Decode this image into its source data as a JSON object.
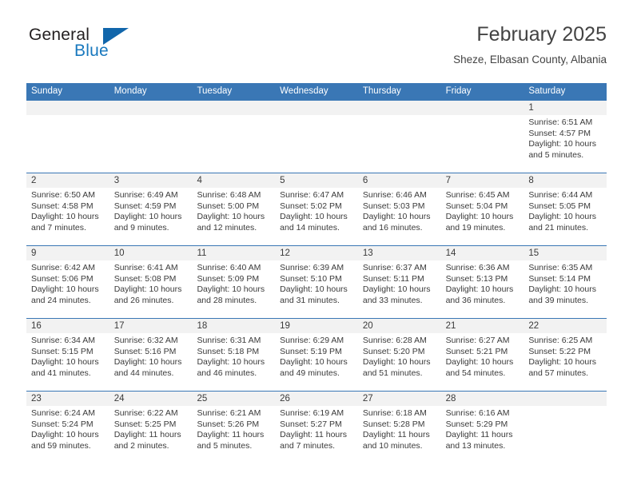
{
  "brand": {
    "name_top": "General",
    "name_bottom": "Blue",
    "accent_color": "#1166ab",
    "text_color": "#231f20"
  },
  "header": {
    "title": "February 2025",
    "subtitle": "Sheze, Elbasan County, Albania"
  },
  "theme": {
    "header_blue": "#3a77b5",
    "daynum_band": "#f2f2f2",
    "body_text": "#3a3a3a"
  },
  "weekdays": [
    "Sunday",
    "Monday",
    "Tuesday",
    "Wednesday",
    "Thursday",
    "Friday",
    "Saturday"
  ],
  "weeks": [
    [
      {
        "day": "",
        "sunrise": "",
        "sunset": "",
        "daylight": "",
        "empty": true
      },
      {
        "day": "",
        "sunrise": "",
        "sunset": "",
        "daylight": "",
        "empty": true
      },
      {
        "day": "",
        "sunrise": "",
        "sunset": "",
        "daylight": "",
        "empty": true
      },
      {
        "day": "",
        "sunrise": "",
        "sunset": "",
        "daylight": "",
        "empty": true
      },
      {
        "day": "",
        "sunrise": "",
        "sunset": "",
        "daylight": "",
        "empty": true
      },
      {
        "day": "",
        "sunrise": "",
        "sunset": "",
        "daylight": "",
        "empty": true
      },
      {
        "day": "1",
        "sunrise": "Sunrise: 6:51 AM",
        "sunset": "Sunset: 4:57 PM",
        "daylight": "Daylight: 10 hours and 5 minutes.",
        "empty": false
      }
    ],
    [
      {
        "day": "2",
        "sunrise": "Sunrise: 6:50 AM",
        "sunset": "Sunset: 4:58 PM",
        "daylight": "Daylight: 10 hours and 7 minutes.",
        "empty": false
      },
      {
        "day": "3",
        "sunrise": "Sunrise: 6:49 AM",
        "sunset": "Sunset: 4:59 PM",
        "daylight": "Daylight: 10 hours and 9 minutes.",
        "empty": false
      },
      {
        "day": "4",
        "sunrise": "Sunrise: 6:48 AM",
        "sunset": "Sunset: 5:00 PM",
        "daylight": "Daylight: 10 hours and 12 minutes.",
        "empty": false
      },
      {
        "day": "5",
        "sunrise": "Sunrise: 6:47 AM",
        "sunset": "Sunset: 5:02 PM",
        "daylight": "Daylight: 10 hours and 14 minutes.",
        "empty": false
      },
      {
        "day": "6",
        "sunrise": "Sunrise: 6:46 AM",
        "sunset": "Sunset: 5:03 PM",
        "daylight": "Daylight: 10 hours and 16 minutes.",
        "empty": false
      },
      {
        "day": "7",
        "sunrise": "Sunrise: 6:45 AM",
        "sunset": "Sunset: 5:04 PM",
        "daylight": "Daylight: 10 hours and 19 minutes.",
        "empty": false
      },
      {
        "day": "8",
        "sunrise": "Sunrise: 6:44 AM",
        "sunset": "Sunset: 5:05 PM",
        "daylight": "Daylight: 10 hours and 21 minutes.",
        "empty": false
      }
    ],
    [
      {
        "day": "9",
        "sunrise": "Sunrise: 6:42 AM",
        "sunset": "Sunset: 5:06 PM",
        "daylight": "Daylight: 10 hours and 24 minutes.",
        "empty": false
      },
      {
        "day": "10",
        "sunrise": "Sunrise: 6:41 AM",
        "sunset": "Sunset: 5:08 PM",
        "daylight": "Daylight: 10 hours and 26 minutes.",
        "empty": false
      },
      {
        "day": "11",
        "sunrise": "Sunrise: 6:40 AM",
        "sunset": "Sunset: 5:09 PM",
        "daylight": "Daylight: 10 hours and 28 minutes.",
        "empty": false
      },
      {
        "day": "12",
        "sunrise": "Sunrise: 6:39 AM",
        "sunset": "Sunset: 5:10 PM",
        "daylight": "Daylight: 10 hours and 31 minutes.",
        "empty": false
      },
      {
        "day": "13",
        "sunrise": "Sunrise: 6:37 AM",
        "sunset": "Sunset: 5:11 PM",
        "daylight": "Daylight: 10 hours and 33 minutes.",
        "empty": false
      },
      {
        "day": "14",
        "sunrise": "Sunrise: 6:36 AM",
        "sunset": "Sunset: 5:13 PM",
        "daylight": "Daylight: 10 hours and 36 minutes.",
        "empty": false
      },
      {
        "day": "15",
        "sunrise": "Sunrise: 6:35 AM",
        "sunset": "Sunset: 5:14 PM",
        "daylight": "Daylight: 10 hours and 39 minutes.",
        "empty": false
      }
    ],
    [
      {
        "day": "16",
        "sunrise": "Sunrise: 6:34 AM",
        "sunset": "Sunset: 5:15 PM",
        "daylight": "Daylight: 10 hours and 41 minutes.",
        "empty": false
      },
      {
        "day": "17",
        "sunrise": "Sunrise: 6:32 AM",
        "sunset": "Sunset: 5:16 PM",
        "daylight": "Daylight: 10 hours and 44 minutes.",
        "empty": false
      },
      {
        "day": "18",
        "sunrise": "Sunrise: 6:31 AM",
        "sunset": "Sunset: 5:18 PM",
        "daylight": "Daylight: 10 hours and 46 minutes.",
        "empty": false
      },
      {
        "day": "19",
        "sunrise": "Sunrise: 6:29 AM",
        "sunset": "Sunset: 5:19 PM",
        "daylight": "Daylight: 10 hours and 49 minutes.",
        "empty": false
      },
      {
        "day": "20",
        "sunrise": "Sunrise: 6:28 AM",
        "sunset": "Sunset: 5:20 PM",
        "daylight": "Daylight: 10 hours and 51 minutes.",
        "empty": false
      },
      {
        "day": "21",
        "sunrise": "Sunrise: 6:27 AM",
        "sunset": "Sunset: 5:21 PM",
        "daylight": "Daylight: 10 hours and 54 minutes.",
        "empty": false
      },
      {
        "day": "22",
        "sunrise": "Sunrise: 6:25 AM",
        "sunset": "Sunset: 5:22 PM",
        "daylight": "Daylight: 10 hours and 57 minutes.",
        "empty": false
      }
    ],
    [
      {
        "day": "23",
        "sunrise": "Sunrise: 6:24 AM",
        "sunset": "Sunset: 5:24 PM",
        "daylight": "Daylight: 10 hours and 59 minutes.",
        "empty": false
      },
      {
        "day": "24",
        "sunrise": "Sunrise: 6:22 AM",
        "sunset": "Sunset: 5:25 PM",
        "daylight": "Daylight: 11 hours and 2 minutes.",
        "empty": false
      },
      {
        "day": "25",
        "sunrise": "Sunrise: 6:21 AM",
        "sunset": "Sunset: 5:26 PM",
        "daylight": "Daylight: 11 hours and 5 minutes.",
        "empty": false
      },
      {
        "day": "26",
        "sunrise": "Sunrise: 6:19 AM",
        "sunset": "Sunset: 5:27 PM",
        "daylight": "Daylight: 11 hours and 7 minutes.",
        "empty": false
      },
      {
        "day": "27",
        "sunrise": "Sunrise: 6:18 AM",
        "sunset": "Sunset: 5:28 PM",
        "daylight": "Daylight: 11 hours and 10 minutes.",
        "empty": false
      },
      {
        "day": "28",
        "sunrise": "Sunrise: 6:16 AM",
        "sunset": "Sunset: 5:29 PM",
        "daylight": "Daylight: 11 hours and 13 minutes.",
        "empty": false
      },
      {
        "day": "",
        "sunrise": "",
        "sunset": "",
        "daylight": "",
        "empty": true
      }
    ]
  ]
}
